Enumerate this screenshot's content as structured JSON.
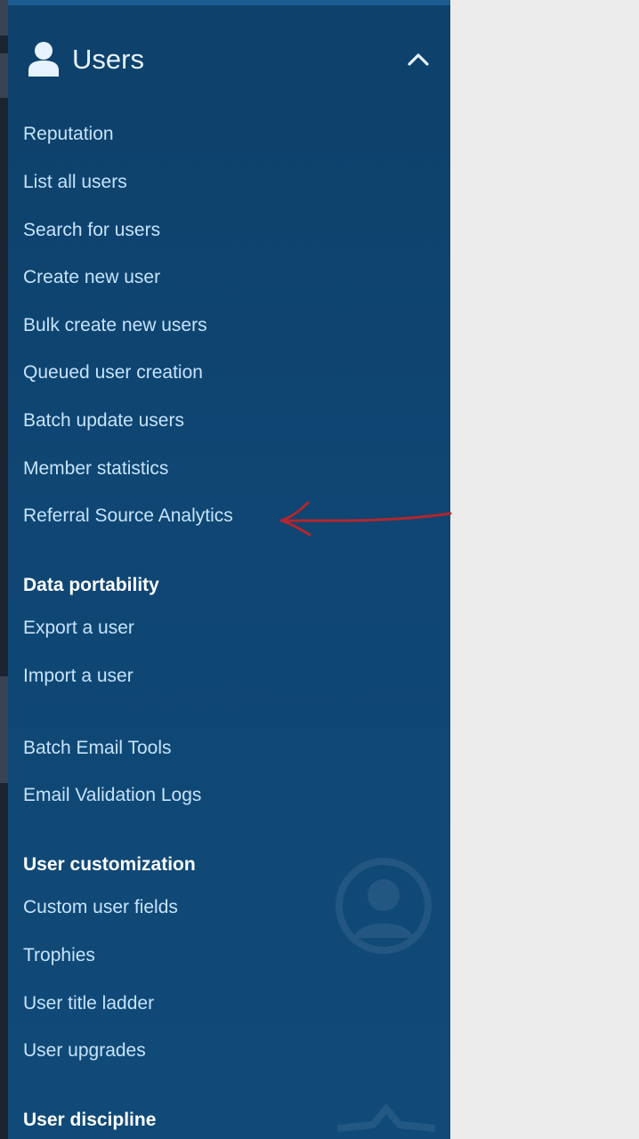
{
  "header": {
    "title": "Users",
    "icon": "user-icon",
    "toggle_icon": "chevron-up-icon"
  },
  "groups": {
    "users": {
      "items": [
        "Reputation",
        "List all users",
        "Search for users",
        "Create new user",
        "Bulk create new users",
        "Queued user creation",
        "Batch update users",
        "Member statistics",
        "Referral Source Analytics"
      ]
    },
    "data_portability": {
      "heading": "Data portability",
      "items": [
        "Export a user",
        "Import a user"
      ]
    },
    "email": {
      "items": [
        "Batch Email Tools",
        "Email Validation Logs"
      ]
    },
    "user_customization": {
      "heading": "User customization",
      "items": [
        "Custom user fields",
        "Trophies",
        "User title ladder",
        "User upgrades"
      ]
    },
    "user_discipline": {
      "heading": "User discipline"
    }
  },
  "colors": {
    "panel_background": "#0f4673",
    "link_text": "#c6e3fb",
    "heading_text": "#ffffff",
    "annotation_arrow": "#b3262e",
    "page_background": "#ececec"
  }
}
